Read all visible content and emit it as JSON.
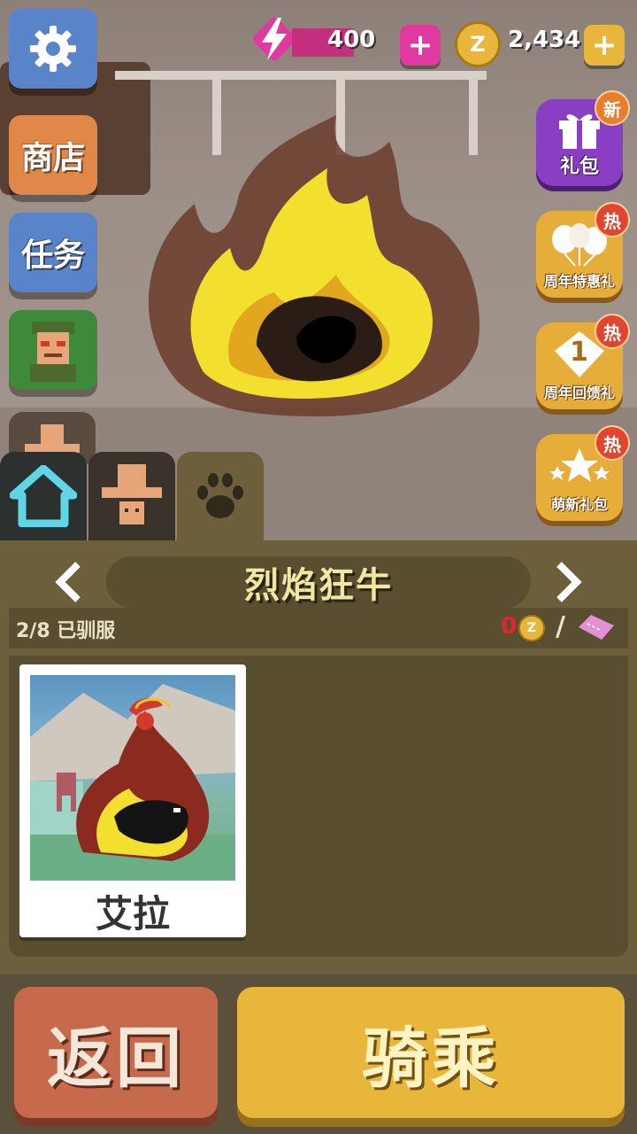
{
  "hud": {
    "energy_value": "400",
    "coins_value": "2,434"
  },
  "left_menu": {
    "shop_label": "商店",
    "missions_label": "任务"
  },
  "right_menu": {
    "gift_pack_label": "礼包",
    "gift_pack_badge": "新",
    "anniversary_sale_label": "周年特惠礼",
    "anniversary_sale_badge": "热",
    "anniversary_return_label": "周年回馈礼",
    "anniversary_return_badge": "热",
    "anniversary_return_number": "1",
    "newbie_pack_label": "萌新礼包",
    "newbie_pack_badge": "热"
  },
  "panel": {
    "title": "烈焰狂牛",
    "tamed_status": "2/8 已驯服",
    "coin_cost": "0",
    "card_name": "艾拉"
  },
  "buttons": {
    "back_label": "返回",
    "ride_label": "骑乘"
  },
  "colors": {
    "shop": "#e0874a",
    "missions": "#5a84c9",
    "ride": "#e8b63a",
    "back": "#c76a4c",
    "energy": "#e03aa0",
    "coin": "#e8b63a",
    "hot_badge": "#e0462e"
  },
  "icons": {
    "settings": "gear-icon",
    "home": "home-icon",
    "cowboy": "cowboy-hat-icon",
    "pets": "paw-icon",
    "energy": "lightning-icon",
    "coin": "z-coin-icon",
    "ticket": "ticket-icon",
    "gift": "gift-box-icon"
  }
}
